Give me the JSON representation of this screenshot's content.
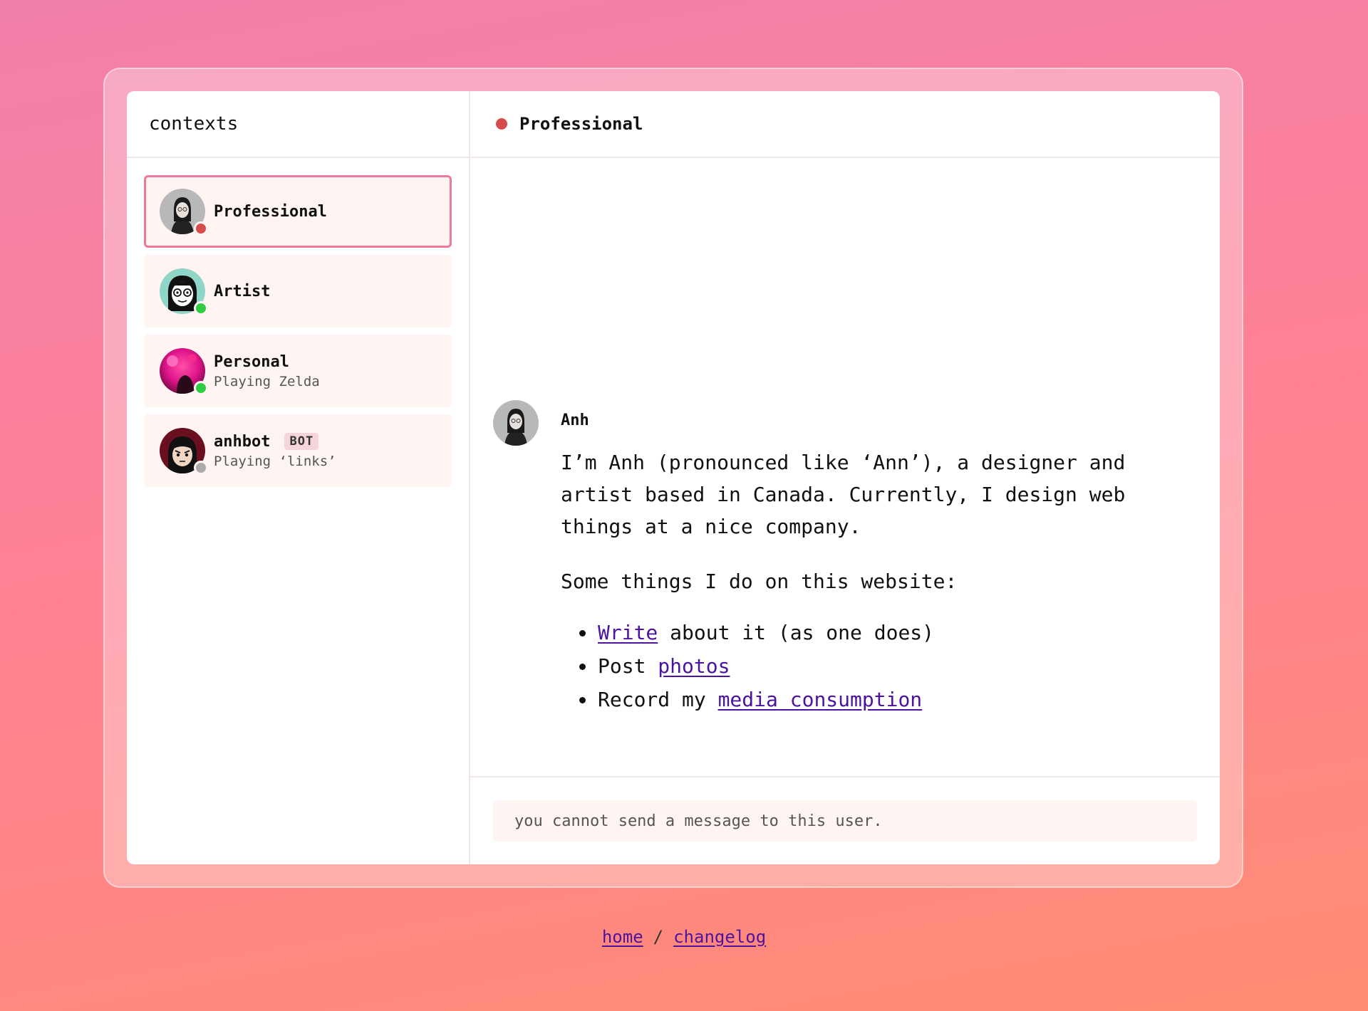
{
  "sidebar": {
    "title": "contexts",
    "items": [
      {
        "name": "Professional",
        "sub": "",
        "status": "busy",
        "avatar_icon": "professional-avatar-icon"
      },
      {
        "name": "Artist",
        "sub": "",
        "status": "online",
        "avatar_icon": "artist-avatar-icon"
      },
      {
        "name": "Personal",
        "sub": "Playing Zelda",
        "status": "online",
        "avatar_icon": "personal-avatar-icon"
      },
      {
        "name": "anhbot",
        "badge": "BOT",
        "sub": "Playing ‘links’",
        "status": "offline",
        "avatar_icon": "anhbot-avatar-icon"
      }
    ]
  },
  "channel": {
    "title": "Professional",
    "status_color": "#d64b4b"
  },
  "message": {
    "author": "Anh",
    "paragraph1": "I’m Anh (pronounced like ‘Ann’), a designer and artist based in Canada. Currently, I design web things at a nice company.",
    "paragraph2": "Some things I do on this website:",
    "list": [
      {
        "link": "Write",
        "after": " about it (as one does)"
      },
      {
        "before": "Post ",
        "link": "photos"
      },
      {
        "before": "Record my ",
        "link": "media consumption"
      }
    ]
  },
  "composer": {
    "text": "you cannot send a message to this user."
  },
  "footer": {
    "home": "home",
    "separator": "/",
    "changelog": "changelog"
  },
  "colors": {
    "busy": "#d64b4b",
    "online": "#2ecc40",
    "offline": "#aaaaaa",
    "active_border": "#ee7a9b",
    "link": "#4b13a0"
  }
}
